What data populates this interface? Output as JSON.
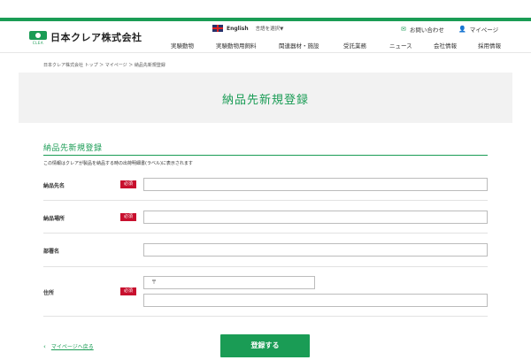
{
  "header": {
    "logo_text": "日本クレア株式会社",
    "logo_sub": "CLEA",
    "language": {
      "english_label": "English",
      "select_label": "言語を選択▼"
    },
    "contact_label": "お問い合わせ",
    "mypage_label": "マイページ",
    "nav": [
      "実験動物",
      "実験動物用飼料",
      "関連器材・施設",
      "受託業務",
      "ニュース",
      "会社情報",
      "採用情報"
    ]
  },
  "breadcrumb": "日本クレア株式会社 トップ ＞ マイページ ＞ 納品先新規登録",
  "page_title": "納品先新規登録",
  "form": {
    "section_title": "納品先新規登録",
    "note": "この情報はクレアが製品を納品する時の出荷明細書(ラベル)に表示されます",
    "required_label": "必須",
    "fields": [
      {
        "label": "納品先名",
        "required": true,
        "value": ""
      },
      {
        "label": "納品場所",
        "required": true,
        "value": ""
      },
      {
        "label": "部署名",
        "required": false,
        "value": ""
      },
      {
        "label": "住所",
        "required": true,
        "postal_prefix": "〒",
        "value": ""
      }
    ]
  },
  "footer": {
    "back_chevron": "‹",
    "back_label": "マイページへ戻る",
    "submit_label": "登録する"
  },
  "colors": {
    "brand_green": "#1a9c55",
    "required_red": "#c8102e",
    "banner_gray": "#f2f2f2"
  }
}
